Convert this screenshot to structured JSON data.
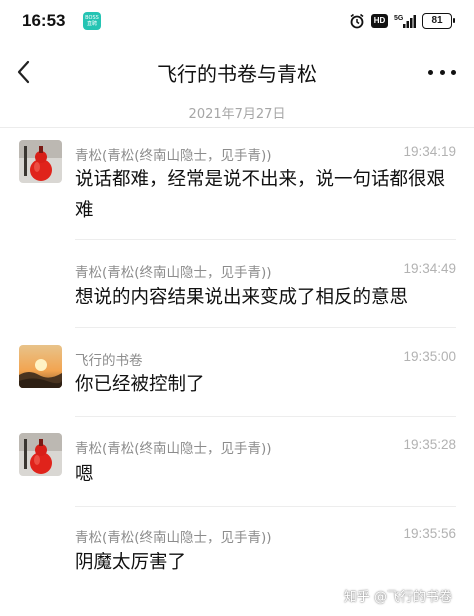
{
  "status_bar": {
    "time": "16:53",
    "app_icon_label": "BOSS直聘",
    "hd_label": "HD",
    "network_label": "5G",
    "battery_level": "81"
  },
  "nav": {
    "title": "飞行的书卷与青松",
    "back_icon": "chevron-left-icon",
    "more_icon": "more-horizontal-icon"
  },
  "date_divider": "2021年7月27日",
  "messages": [
    {
      "sender": "青松(青松(终南山隐士，见手青))",
      "time": "19:34:19",
      "text": "说话都难，经常是说不出来，说一句话都很艰难",
      "avatar": "green-pine-avatar",
      "show_avatar": true
    },
    {
      "sender": "青松(青松(终南山隐士，见手青))",
      "time": "19:34:49",
      "text": "想说的内容结果说出来变成了相反的意思",
      "avatar": "",
      "show_avatar": false
    },
    {
      "sender": "飞行的书卷",
      "time": "19:35:00",
      "text": "你已经被控制了",
      "avatar": "sunset-avatar",
      "show_avatar": true
    },
    {
      "sender": "青松(青松(终南山隐士，见手青))",
      "time": "19:35:28",
      "text": "嗯",
      "avatar": "green-pine-avatar",
      "show_avatar": true
    },
    {
      "sender": "青松(青松(终南山隐士，见手青))",
      "time": "19:35:56",
      "text": "阴魔太厉害了",
      "avatar": "",
      "show_avatar": false
    }
  ],
  "watermark": "知乎 @飞行的书卷",
  "colors": {
    "background": "#ffffff",
    "meta_text": "#8c8c8c",
    "divider": "#ededed"
  }
}
